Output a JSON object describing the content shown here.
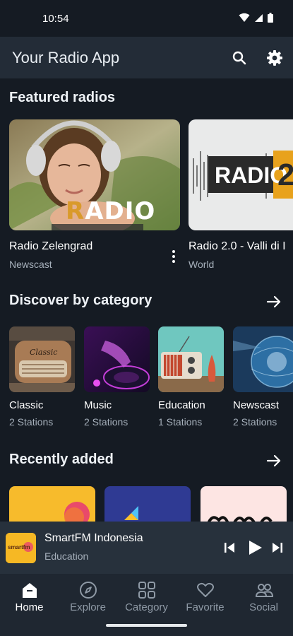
{
  "status_bar": {
    "time": "10:54"
  },
  "app_bar": {
    "title": "Your Radio App",
    "search_icon": "search-icon",
    "settings_icon": "gear-icon"
  },
  "featured": {
    "title": "Featured radios",
    "items": [
      {
        "name": "Radio Zelengrad",
        "category": "Newscast",
        "logo_text": "RADIO"
      },
      {
        "name": "Radio 2.0 - Valli di I",
        "category": "World",
        "logo_text": "RADIO 2"
      }
    ]
  },
  "categories": {
    "title": "Discover by category",
    "items": [
      {
        "name": "Classic",
        "count": "2 Stations"
      },
      {
        "name": "Music",
        "count": "2 Stations"
      },
      {
        "name": "Education",
        "count": "1 Stations"
      },
      {
        "name": "Newscast",
        "count": "2 Stations"
      }
    ]
  },
  "recent": {
    "title": "Recently added"
  },
  "player": {
    "title": "SmartFM Indonesia",
    "subtitle": "Education",
    "art_text": "smartfm"
  },
  "nav": {
    "items": [
      {
        "label": "Home",
        "icon": "home-icon",
        "active": true
      },
      {
        "label": "Explore",
        "icon": "compass-icon"
      },
      {
        "label": "Category",
        "icon": "grid-icon"
      },
      {
        "label": "Favorite",
        "icon": "heart-icon"
      },
      {
        "label": "Social",
        "icon": "people-icon"
      }
    ]
  },
  "colors": {
    "background": "#151b23",
    "app_bar": "#232c37",
    "player": "#27313c",
    "nav": "#1f2731",
    "muted_text": "#a6b0bb"
  }
}
